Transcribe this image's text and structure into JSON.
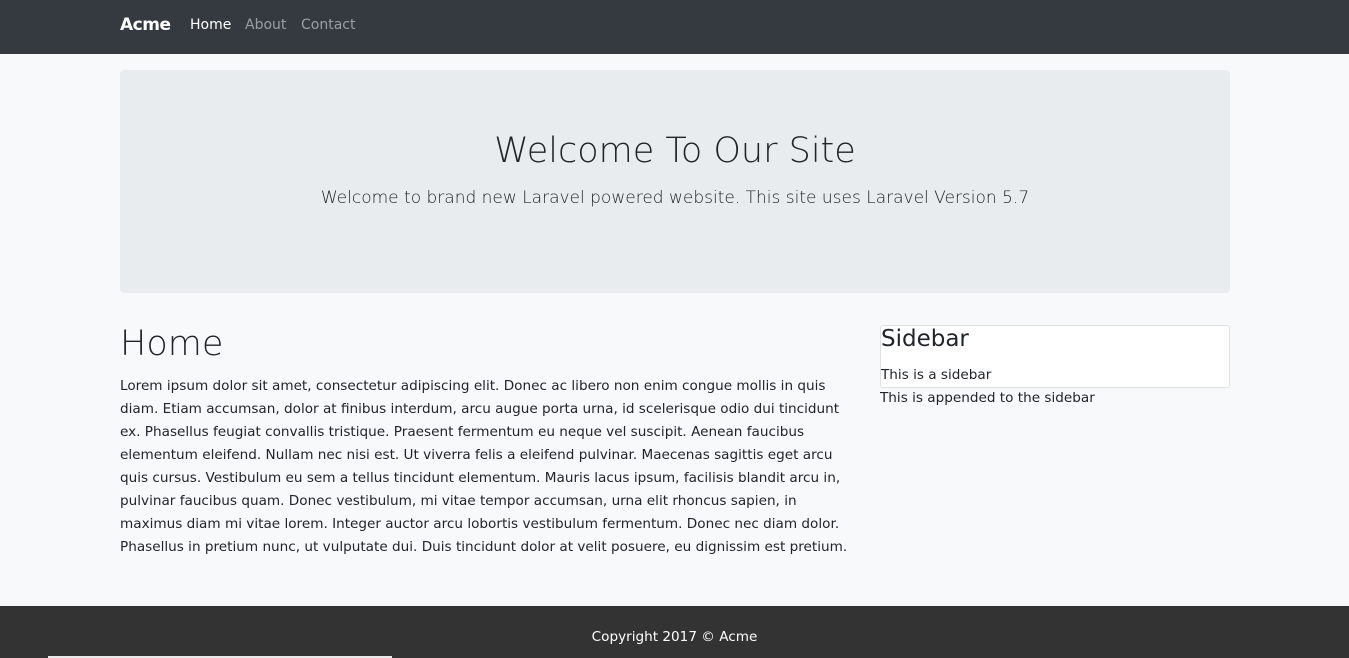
{
  "navbar": {
    "brand": "Acme",
    "links": [
      {
        "label": "Home",
        "active": true
      },
      {
        "label": "About",
        "active": false
      },
      {
        "label": "Contact",
        "active": false
      }
    ],
    "background": "#343a40"
  },
  "jumbotron": {
    "title": "Welcome To Our Site",
    "lead": "Welcome to brand new Laravel powered website. This site uses Laravel Version 5.7",
    "background": "#e9ecef"
  },
  "main": {
    "heading": "Home",
    "body": "Lorem ipsum dolor sit amet, consectetur adipiscing elit. Donec ac libero non enim congue mollis in quis diam. Etiam accumsan, dolor at finibus interdum, arcu augue porta urna, id scelerisque odio dui tincidunt ex. Phasellus feugiat convallis tristique. Praesent fermentum eu neque vel suscipit. Aenean faucibus elementum eleifend. Nullam nec nisi est. Ut viverra felis a eleifend pulvinar. Maecenas sagittis eget arcu quis cursus. Vestibulum eu sem a tellus tincidunt elementum. Mauris lacus ipsum, facilisis blandit arcu in, pulvinar faucibus quam. Donec vestibulum, mi vitae tempor accumsan, urna elit rhoncus sapien, in maximus diam mi vitae lorem. Integer auctor arcu lobortis vestibulum fermentum. Donec nec diam dolor. Phasellus in pretium nunc, ut vulputate dui. Duis tincidunt dolor at velit posuere, eu dignissim est pretium."
  },
  "sidebar": {
    "title": "Sidebar",
    "text": "This is a sidebar",
    "appended": "This is appended to the sidebar"
  },
  "footer": {
    "text": "Copyright 2017 © Acme",
    "background": "#333333"
  }
}
